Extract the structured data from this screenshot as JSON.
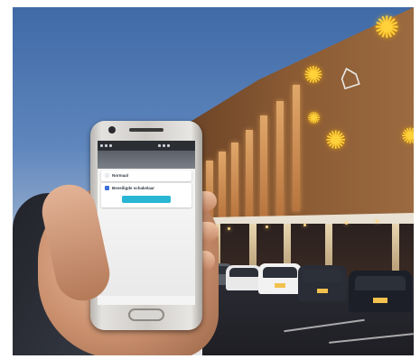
{
  "scene": {
    "description_colors": {
      "sky_top": "#3f6aa6",
      "facade": "#8a5a33",
      "star_lights": "#ffd23c",
      "app_button": "#29b6d4"
    },
    "icons": [
      "star-light-icon",
      "bird-logo-icon"
    ]
  },
  "phone_screen": {
    "statusbar": {
      "left": "",
      "right": ""
    },
    "option_1": {
      "title": "Normaal",
      "subtitle": ""
    },
    "option_2": {
      "title": "Beveiligde schakelaar",
      "subtitle": ""
    },
    "button_label": ""
  }
}
